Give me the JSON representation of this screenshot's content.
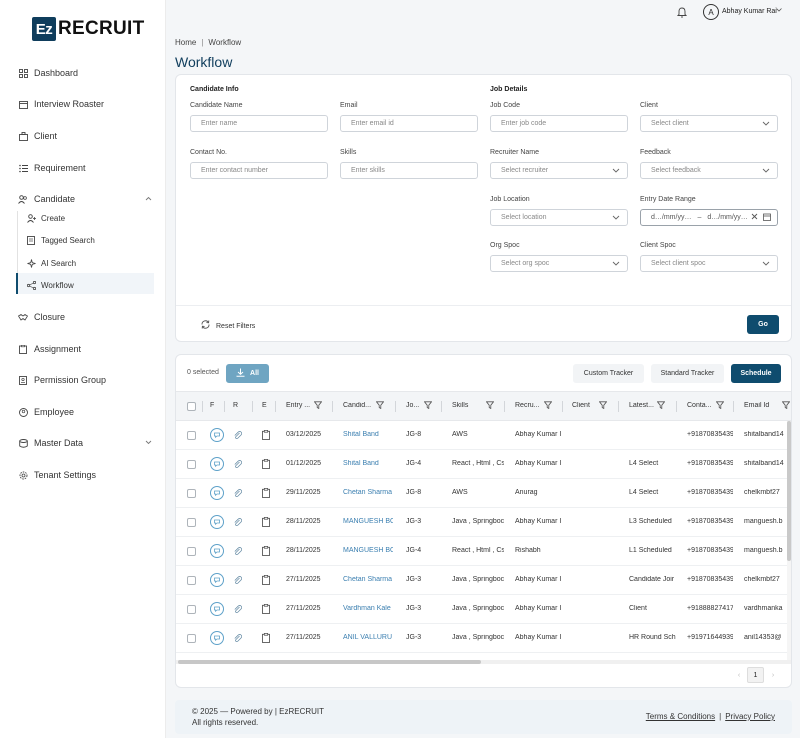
{
  "brand": {
    "logo_mark": "Ez",
    "logo_text": "RECRUIT"
  },
  "sidebar": {
    "items": [
      {
        "label": "Dashboard",
        "icon": "grid-icon"
      },
      {
        "label": "Interview Roaster",
        "icon": "calendar-icon"
      },
      {
        "label": "Client",
        "icon": "briefcase-icon"
      },
      {
        "label": "Requirement",
        "icon": "list-icon"
      },
      {
        "label": "Candidate",
        "icon": "users-icon"
      },
      {
        "label": "Closure",
        "icon": "handshake-icon"
      },
      {
        "label": "Assignment",
        "icon": "clipboard-icon"
      },
      {
        "label": "Permission Group",
        "icon": "id-card-icon"
      },
      {
        "label": "Employee",
        "icon": "person-circle-icon"
      },
      {
        "label": "Master Data",
        "icon": "database-icon"
      },
      {
        "label": "Tenant Settings",
        "icon": "gear-icon"
      }
    ],
    "candidate_sub": [
      {
        "label": "Create"
      },
      {
        "label": "Tagged Search"
      },
      {
        "label": "AI Search"
      },
      {
        "label": "Workflow"
      }
    ]
  },
  "topbar": {
    "avatar_initial": "A",
    "user_name": "Abhay Kumar Rai"
  },
  "breadcrumb": {
    "home": "Home",
    "sep": "|",
    "current": "Workflow"
  },
  "page_title": "Workflow",
  "filters": {
    "candidate_info_title": "Candidate Info",
    "job_details_title": "Job Details",
    "candidate_name": {
      "label": "Candidate Name",
      "placeholder": "Enter name"
    },
    "email": {
      "label": "Email",
      "placeholder": "Enter email id"
    },
    "contact": {
      "label": "Contact No.",
      "placeholder": "Enter contact number"
    },
    "skills": {
      "label": "Skills",
      "placeholder": "Enter skills"
    },
    "job_code": {
      "label": "Job Code",
      "placeholder": "Enter job code"
    },
    "client": {
      "label": "Client",
      "placeholder": "Select client"
    },
    "recruiter": {
      "label": "Recruiter Name",
      "placeholder": "Select recruiter"
    },
    "feedback": {
      "label": "Feedback",
      "placeholder": "Select feedback"
    },
    "job_location": {
      "label": "Job Location",
      "placeholder": "Select location"
    },
    "entry_date": {
      "label": "Entry Date Range",
      "from": "d…/mm/yy…",
      "to_sep": "–",
      "to": "d…/mm/yy…"
    },
    "org_spoc": {
      "label": "Org Spoc",
      "placeholder": "Select org spoc"
    },
    "client_spoc": {
      "label": "Client Spoc",
      "placeholder": "Select client spoc"
    },
    "reset_label": "Reset Filters",
    "go_label": "Go"
  },
  "table": {
    "selected_text": "0 selected",
    "all_label": "All",
    "custom_tracker": "Custom Tracker",
    "standard_tracker": "Standard Tracker",
    "schedule": "Schedule",
    "columns": [
      "F",
      "R",
      "E",
      "Entry ...",
      "Candid...",
      "Jo...",
      "Skills",
      "Recru...",
      "Client",
      "Latest...",
      "Conta...",
      "Email Id"
    ],
    "rows": [
      {
        "entry": "03/12/2025",
        "candidate": "Shital Band",
        "job": "JG-8",
        "skills": "AWS",
        "recruiter": "Abhay Kumar I",
        "client": "",
        "latest": "",
        "contact": "+91870835439",
        "email": "shitalband14"
      },
      {
        "entry": "01/12/2025",
        "candidate": "Shital Band",
        "job": "JG-4",
        "skills": "React , Html , Cs",
        "recruiter": "Abhay Kumar I",
        "client": "",
        "latest": "L4 Select",
        "contact": "+91870835439",
        "email": "shitalband14"
      },
      {
        "entry": "29/11/2025",
        "candidate": "Chetan Sharma",
        "job": "JG-8",
        "skills": "AWS",
        "recruiter": "Anurag",
        "client": "",
        "latest": "L4 Select",
        "contact": "+91870835439",
        "email": "chelkmbf27"
      },
      {
        "entry": "28/11/2025",
        "candidate": "MANGUESH BO",
        "job": "JG-3",
        "skills": "Java , Springboc",
        "recruiter": "Abhay Kumar I",
        "client": "",
        "latest": "L3 Scheduled",
        "contact": "+91870835439",
        "email": "manguesh.b"
      },
      {
        "entry": "28/11/2025",
        "candidate": "MANGUESH BO",
        "job": "JG-4",
        "skills": "React , Html , Cs",
        "recruiter": "Rishabh",
        "client": "",
        "latest": "L1 Scheduled",
        "contact": "+91870835439",
        "email": "manguesh.b"
      },
      {
        "entry": "27/11/2025",
        "candidate": "Chetan Sharma",
        "job": "JG-3",
        "skills": "Java , Springboc",
        "recruiter": "Abhay Kumar I",
        "client": "",
        "latest": "Candidate Joir",
        "contact": "+91870835439",
        "email": "chelkmbf27"
      },
      {
        "entry": "27/11/2025",
        "candidate": "Vardhman Kale",
        "job": "JG-3",
        "skills": "Java , Springboc",
        "recruiter": "Abhay Kumar I",
        "client": "",
        "latest": "Client",
        "contact": "+91888827417",
        "email": "vardhmanka"
      },
      {
        "entry": "27/11/2025",
        "candidate": "ANIL VALLURU",
        "job": "JG-3",
        "skills": "Java , Springboc",
        "recruiter": "Abhay Kumar I",
        "client": "",
        "latest": "HR Round Sch",
        "contact": "+91971644939",
        "email": "anil14353@"
      }
    ],
    "page": "1",
    "prev": "‹",
    "next": "›"
  },
  "footer": {
    "copyright": "© 2025 — Powered by | EzRECRUIT",
    "rights": "All rights reserved.",
    "terms": "Terms & Conditions",
    "sep": "|",
    "privacy": "Privacy Policy"
  }
}
